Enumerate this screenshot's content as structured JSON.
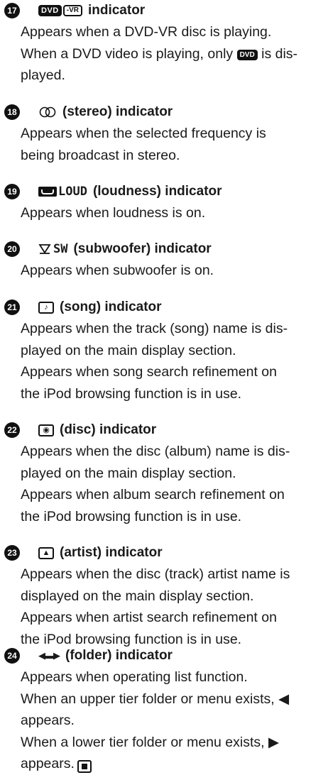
{
  "entries": [
    {
      "num": "17",
      "icon": "dvd-vr-badge-icon",
      "icon_text": {
        "dvd": "DVD",
        "vr": "-VR"
      },
      "title": "indicator",
      "lines": [
        "Appears when a DVD-VR disc is playing.",
        {
          "before": "When a DVD video is playing, only ",
          "badge": "DVD",
          "after": " is dis-"
        },
        "played."
      ]
    },
    {
      "num": "18",
      "icon": "stereo-icon",
      "icon_text": "◯◯",
      "title": "(stereo) indicator",
      "lines": [
        "Appears when the selected frequency is",
        "being broadcast in stereo."
      ]
    },
    {
      "num": "19",
      "icon": "loudness-icon",
      "icon_text": "LOUD",
      "title": "(loudness) indicator",
      "lines": [
        "Appears when loudness is on."
      ]
    },
    {
      "num": "20",
      "icon": "subwoofer-icon",
      "icon_text": "SW",
      "title": "(subwoofer) indicator",
      "lines": [
        "Appears when subwoofer is on."
      ]
    },
    {
      "num": "21",
      "icon": "song-icon",
      "icon_text": "♪",
      "title": "(song) indicator",
      "lines": [
        "Appears when the track (song) name is dis-",
        "played on the main display section.",
        "Appears when song search refinement on",
        "the iPod browsing function is in use."
      ]
    },
    {
      "num": "22",
      "icon": "disc-icon",
      "icon_text": "◉",
      "title": "(disc) indicator",
      "lines": [
        "Appears when the disc (album) name is dis-",
        "played on the main display section.",
        "Appears when album search refinement on",
        "the iPod browsing function is in use."
      ]
    },
    {
      "num": "23",
      "icon": "artist-icon",
      "icon_text": "▲",
      "title": "(artist) indicator",
      "lines": [
        "Appears when the disc (track) artist name is",
        "displayed on the main display section.",
        "Appears when artist search refinement on",
        "the iPod browsing function is in use."
      ]
    },
    {
      "num": "24",
      "icon": "folder-icon",
      "icon_text": "◀▬▶",
      "title": "(folder) indicator",
      "lines": [
        "Appears when operating list function.",
        "When an upper tier folder or menu exists, ◀",
        "appears.",
        "When a lower tier folder or menu exists, ▶",
        "appears."
      ],
      "end_icon": "stop-icon"
    }
  ]
}
